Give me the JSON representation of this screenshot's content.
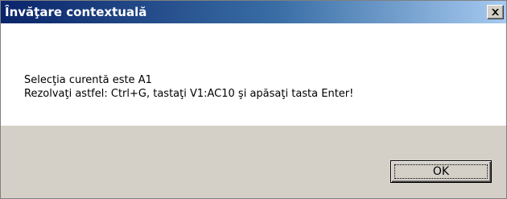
{
  "window": {
    "title": "Învăţare contextuală",
    "close_icon": "close-icon"
  },
  "message": {
    "line1": "Selecţia curentă este A1",
    "line2": "Rezolvaţi astfel: Ctrl+G, tastaţi V1:AC10 şi apăsaţi tasta Enter!"
  },
  "buttons": {
    "ok_label": "OK"
  },
  "colors": {
    "titlebar_start": "#0a246a",
    "titlebar_end": "#a6caf0",
    "dialog_face": "#d4d0c8",
    "content_bg": "#ffffff"
  }
}
